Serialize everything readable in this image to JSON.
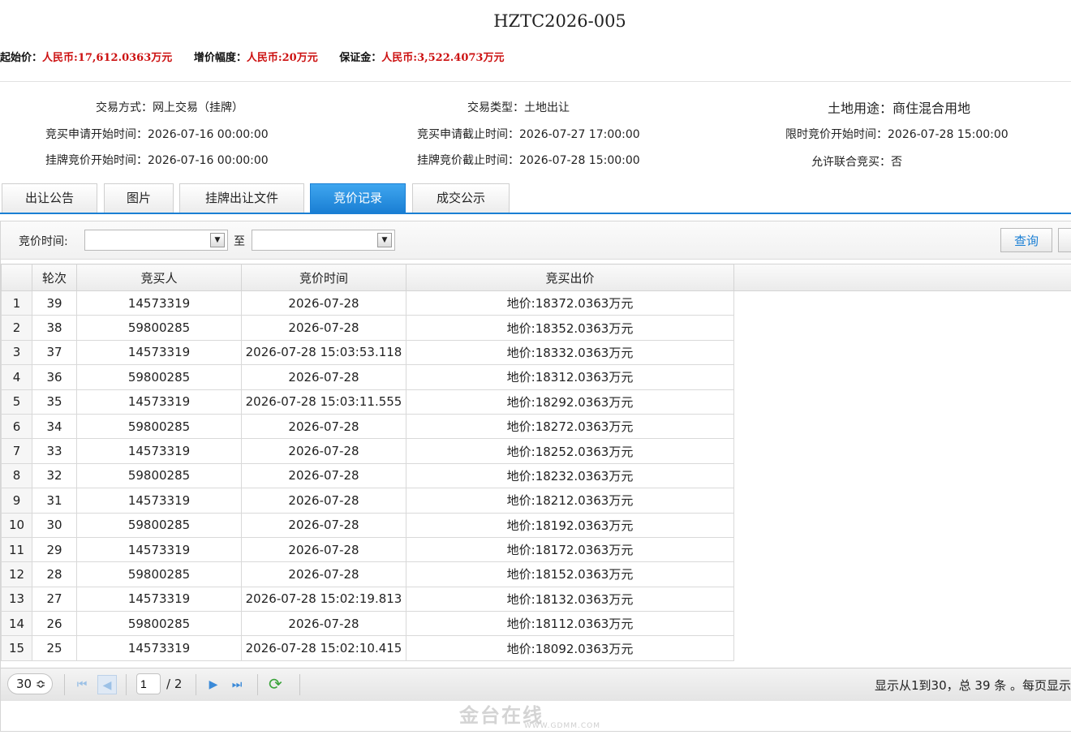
{
  "title": "HZTC2026-005",
  "prices": [
    {
      "label": "起始价：",
      "value": "人民币:17,612.0363万元"
    },
    {
      "label": "增价幅度：",
      "value": "人民币:20万元"
    },
    {
      "label": "保证金：",
      "value": "人民币:3,522.4073万元"
    }
  ],
  "info": {
    "trade_method": {
      "label": "交易方式：",
      "value": "网上交易（挂牌）"
    },
    "trade_type": {
      "label": "交易类型：",
      "value": "土地出让"
    },
    "land_use": {
      "label": "土地用途：",
      "value": "商住混合用地"
    },
    "apply_start": {
      "label": "竞买申请开始时间：",
      "value": "2026-07-16 00:00:00"
    },
    "apply_end": {
      "label": "竞买申请截止时间：",
      "value": "2026-07-27 17:00:00"
    },
    "limit_start": {
      "label": "限时竞价开始时间：",
      "value": "2026-07-28 15:00:00"
    },
    "listing_start": {
      "label": "挂牌竞价开始时间：",
      "value": "2026-07-16 00:00:00"
    },
    "listing_end": {
      "label": "挂牌竞价截止时间：",
      "value": "2026-07-28 15:00:00"
    },
    "joint_bid": {
      "label": "允许联合竞买：",
      "value": "否"
    }
  },
  "tabs": [
    "出让公告",
    "图片",
    "挂牌出让文件",
    "竞价记录",
    "成交公示"
  ],
  "active_tab": "竞价记录",
  "filter": {
    "label": "竞价时间:",
    "to": "至",
    "from_value": "",
    "to_value": "",
    "query_button": "查询"
  },
  "table": {
    "columns": [
      "轮次",
      "竞买人",
      "竞价时间",
      "竞买出价"
    ],
    "rows": [
      [
        "1",
        "39",
        "14573319",
        "2026-07-28",
        "地价:18372.0363万元"
      ],
      [
        "2",
        "38",
        "59800285",
        "2026-07-28",
        "地价:18352.0363万元"
      ],
      [
        "3",
        "37",
        "14573319",
        "2026-07-28 15:03:53.118",
        "地价:18332.0363万元"
      ],
      [
        "4",
        "36",
        "59800285",
        "2026-07-28",
        "地价:18312.0363万元"
      ],
      [
        "5",
        "35",
        "14573319",
        "2026-07-28 15:03:11.555",
        "地价:18292.0363万元"
      ],
      [
        "6",
        "34",
        "59800285",
        "2026-07-28",
        "地价:18272.0363万元"
      ],
      [
        "7",
        "33",
        "14573319",
        "2026-07-28",
        "地价:18252.0363万元"
      ],
      [
        "8",
        "32",
        "59800285",
        "2026-07-28",
        "地价:18232.0363万元"
      ],
      [
        "9",
        "31",
        "14573319",
        "2026-07-28",
        "地价:18212.0363万元"
      ],
      [
        "10",
        "30",
        "59800285",
        "2026-07-28",
        "地价:18192.0363万元"
      ],
      [
        "11",
        "29",
        "14573319",
        "2026-07-28",
        "地价:18172.0363万元"
      ],
      [
        "12",
        "28",
        "59800285",
        "2026-07-28",
        "地价:18152.0363万元"
      ],
      [
        "13",
        "27",
        "14573319",
        "2026-07-28 15:02:19.813",
        "地价:18132.0363万元"
      ],
      [
        "14",
        "26",
        "59800285",
        "2026-07-28",
        "地价:18112.0363万元"
      ],
      [
        "15",
        "25",
        "14573319",
        "2026-07-28 15:02:10.415",
        "地价:18092.0363万元"
      ]
    ]
  },
  "pager": {
    "page_size": "30 ≎",
    "current_page": "1",
    "total_pages": "/ 2",
    "info": "显示从1到30，总 39 条 。每页显示"
  },
  "watermark": {
    "text": "金台在线",
    "url": "WWW.GDMM.COM"
  }
}
